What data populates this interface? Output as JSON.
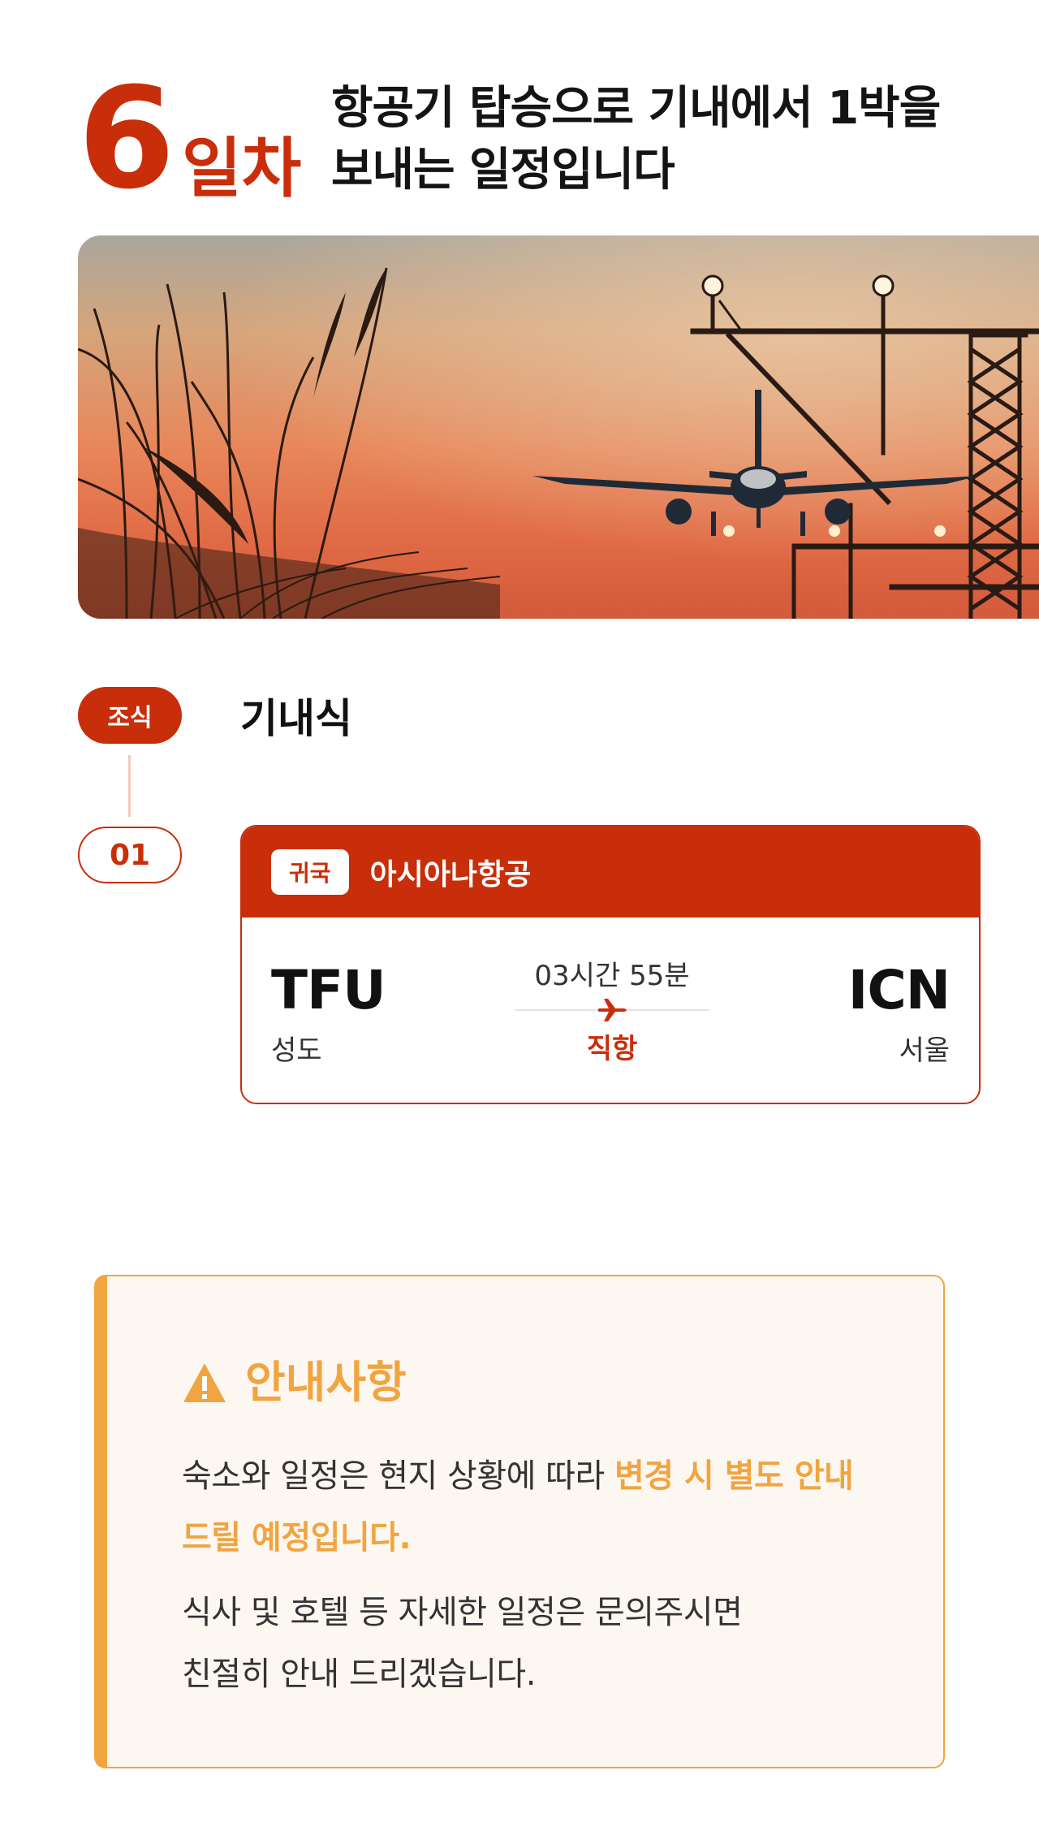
{
  "colors": {
    "primary_red": "#c92e0a",
    "timeline_line": "#f3c9bd",
    "notice_orange": "#f0a540",
    "notice_bg": "#fdf7f2"
  },
  "header": {
    "day_number": "6",
    "day_suffix": "일차",
    "description_line1": "항공기 탑승으로 기내에서 1박을",
    "description_line2": "보내는 일정입니다"
  },
  "hero": {
    "subject": "airplane landing at sunset with approach lights"
  },
  "timeline": {
    "meal_badge": "조식",
    "meal_title": "기내식",
    "step_badge": "01"
  },
  "flight": {
    "tag": "귀국",
    "airline": "아시아나항공",
    "from_code": "TFU",
    "from_city": "성도",
    "to_code": "ICN",
    "to_city": "서울",
    "duration": "03시간 55분",
    "type": "직항",
    "icon": "airplane-icon"
  },
  "notice": {
    "icon": "warning-icon",
    "title": "안내사항",
    "p1_normal": "숙소와 일정은 현지 상황에 따라 ",
    "p1_highlight": "변경 시 별도 안내 드릴 예정입니다.",
    "p2_line1": "식사 및 호텔 등 자세한 일정은 문의주시면",
    "p2_line2": "친절히 안내 드리겠습니다."
  }
}
